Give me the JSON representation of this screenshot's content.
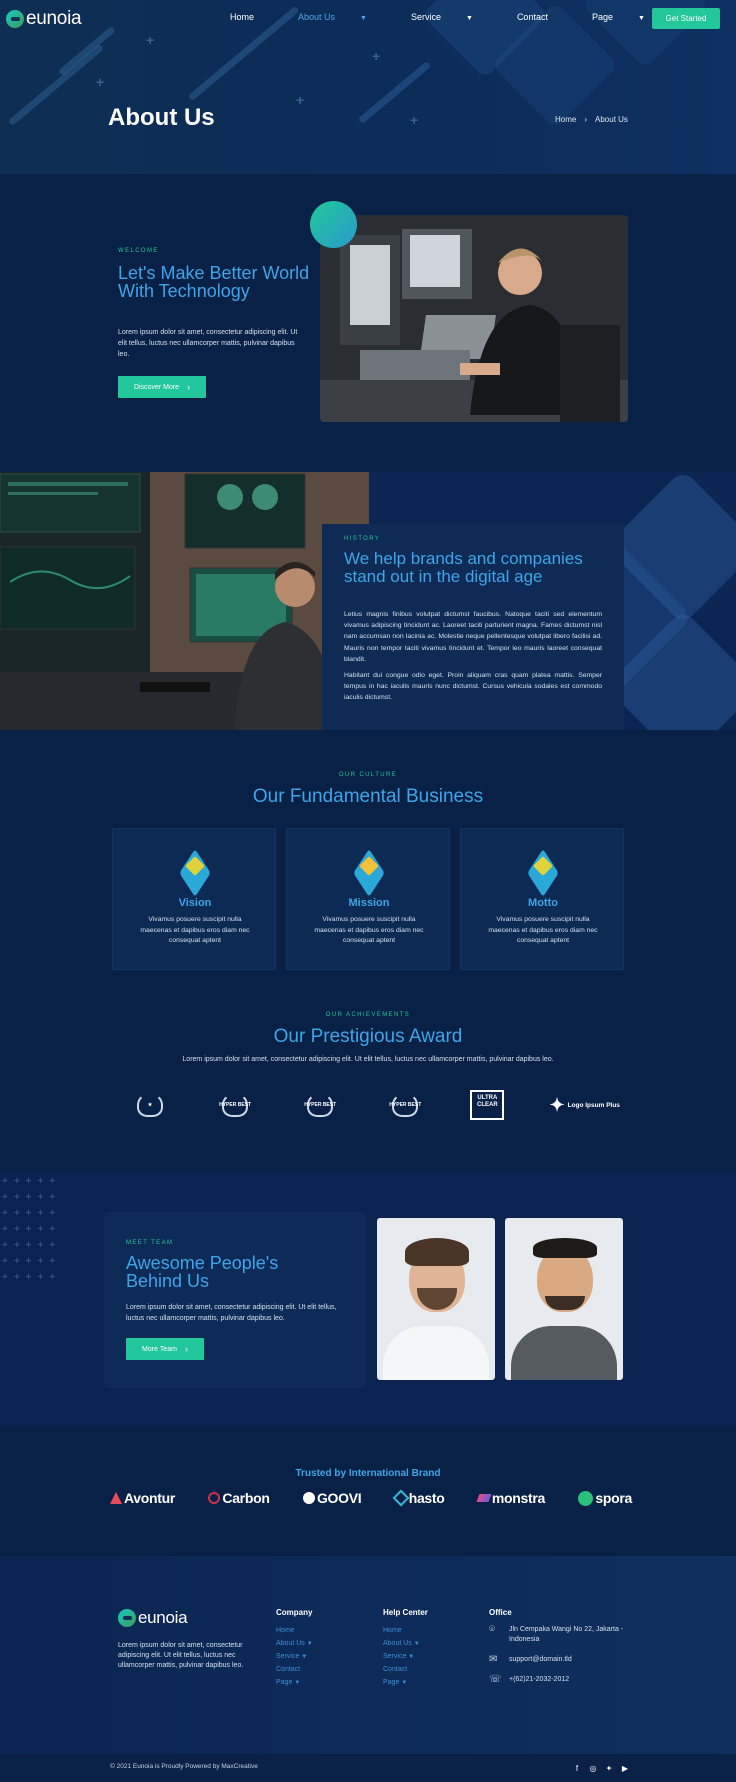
{
  "brand": {
    "name": "eunoia"
  },
  "nav": {
    "items": [
      {
        "label": "Home",
        "dropdown": false
      },
      {
        "label": "About Us",
        "dropdown": true,
        "active": true
      },
      {
        "label": "Service",
        "dropdown": true
      },
      {
        "label": "Contact",
        "dropdown": false
      },
      {
        "label": "Page",
        "dropdown": true
      }
    ],
    "cta": "Get Started"
  },
  "hero": {
    "title": "About Us",
    "breadcrumb": [
      "Home",
      "About Us"
    ]
  },
  "welcome": {
    "eyebrow": "WELCOME",
    "heading": "Let's Make Better World With Technology",
    "text": "Lorem ipsum dolor sit amet, consectetur adipiscing elit. Ut elit tellus, luctus nec ullamcorper mattis, pulvinar dapibus leo.",
    "button": "Discover More"
  },
  "history": {
    "eyebrow": "HISTORY",
    "heading": "We help brands and companies stand out in the digital age",
    "paragraph1": "Letius magnis finibus volutpat dictumst faucibus. Natoque taciti sed elementum vivamus adipiscing tincidunt ac. Laoreet taciti parturient magna. Fames dictumst nisl nam accumsan non lacinia ac. Molestie neque pellentesque volutpat libero facilisi ad. Mauris non tempor taciti vivamus tincidunt et. Tempor leo mauris laoreet consequat blandit.",
    "paragraph2": "Habitant dui congue odio eget. Proin aliquam cras quam platea mattis. Semper tempus in hac iaculis mauris nunc dictumst. Cursus vehicula sodales est commodo iaculis dictumst."
  },
  "culture": {
    "eyebrow": "OUR CULTURE",
    "heading": "Our Fundamental Business",
    "cards": [
      {
        "title": "Vision",
        "text": "Vivamus posuere suscipit nulla maecenas et dapibus eros diam nec consequat aptent"
      },
      {
        "title": "Mission",
        "text": "Vivamus posuere suscipit nulla maecenas et dapibus eros diam nec consequat aptent"
      },
      {
        "title": "Motto",
        "text": "Vivamus posuere suscipit nulla maecenas et dapibus eros diam nec consequat aptent"
      }
    ]
  },
  "awards": {
    "eyebrow": "OUR ACHIEVEMENTS",
    "heading": "Our Prestigious Award",
    "text": "Lorem ipsum dolor sit amet, consectetur adipiscing elit. Ut elit tellus, luctus nec ullamcorper mattis, pulvinar dapibus leo.",
    "badges": [
      "HYPER BEST",
      "HYPER BEST",
      "HYPER BEST",
      "ULTRA CLEAR",
      "Logo Ipsum Plus"
    ]
  },
  "team": {
    "eyebrow": "MEET TEAM",
    "heading": "Awesome People's Behind Us",
    "text": "Lorem ipsum dolor sit amet, consectetur adipiscing elit. Ut elit tellus, luctus nec ullamcorper mattis, pulvinar dapibus leo.",
    "button": "More Team"
  },
  "brands": {
    "heading": "Trusted by International Brand",
    "logos": [
      "Avontur",
      "Carbon",
      "GOOVI",
      "hasto",
      "monstra",
      "spora"
    ]
  },
  "footer": {
    "description": "Lorem ipsum dolor sit amet, consectetur adipiscing elit. Ut elit tellus, luctus nec ullamcorper mattis, pulvinar dapibus leo.",
    "company": {
      "title": "Company",
      "links": [
        "Home",
        "About Us",
        "Service",
        "Contact",
        "Page"
      ]
    },
    "help": {
      "title": "Help Center",
      "links": [
        "Home",
        "About Us",
        "Service",
        "Contact",
        "Page"
      ]
    },
    "office": {
      "title": "Office",
      "address": "Jln Cempaka Wangi No 22, Jakarta - Indonesia",
      "email": "support@domain.tld",
      "phone": "+(62)21-2032-2012"
    },
    "copyright": "© 2021 Eunoia is Proudly Powered by MaxCreative"
  },
  "colors": {
    "accent_green": "#23c79a",
    "accent_blue": "#3fa4e8",
    "bg_navy": "#0a2147"
  }
}
